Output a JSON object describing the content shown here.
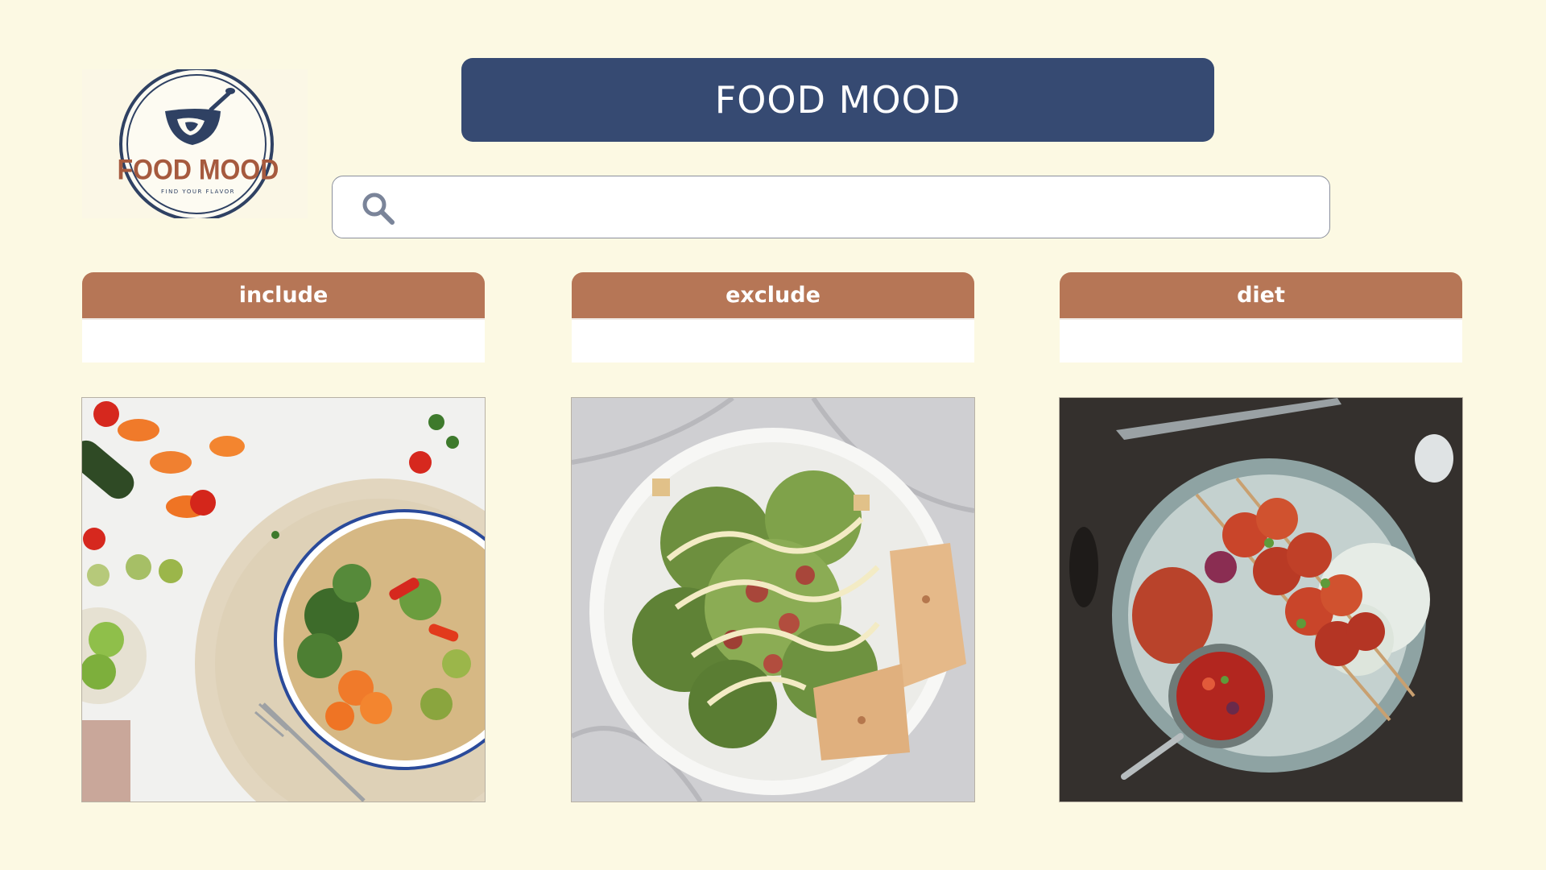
{
  "app": {
    "title": "FOOD MOOD"
  },
  "logo": {
    "brand": "FOOD MOOD",
    "tagline": "FIND YOUR FLAVOR",
    "icon": "bowl-with-spoon-icon"
  },
  "search": {
    "icon": "search-icon",
    "value": "",
    "placeholder": ""
  },
  "filters": [
    {
      "label": "include",
      "value": ""
    },
    {
      "label": "exclude",
      "value": ""
    },
    {
      "label": "diet",
      "value": ""
    }
  ],
  "cards": [
    {
      "image": "vegetable-grain-bowl-photo"
    },
    {
      "image": "caesar-salad-plate-photo"
    },
    {
      "image": "grilled-skewers-plate-photo"
    }
  ],
  "colors": {
    "background": "#fcf9e3",
    "banner": "#364a72",
    "filter_header": "#b67656",
    "logo_navy": "#2f4163",
    "logo_brown": "#a65a3e"
  }
}
